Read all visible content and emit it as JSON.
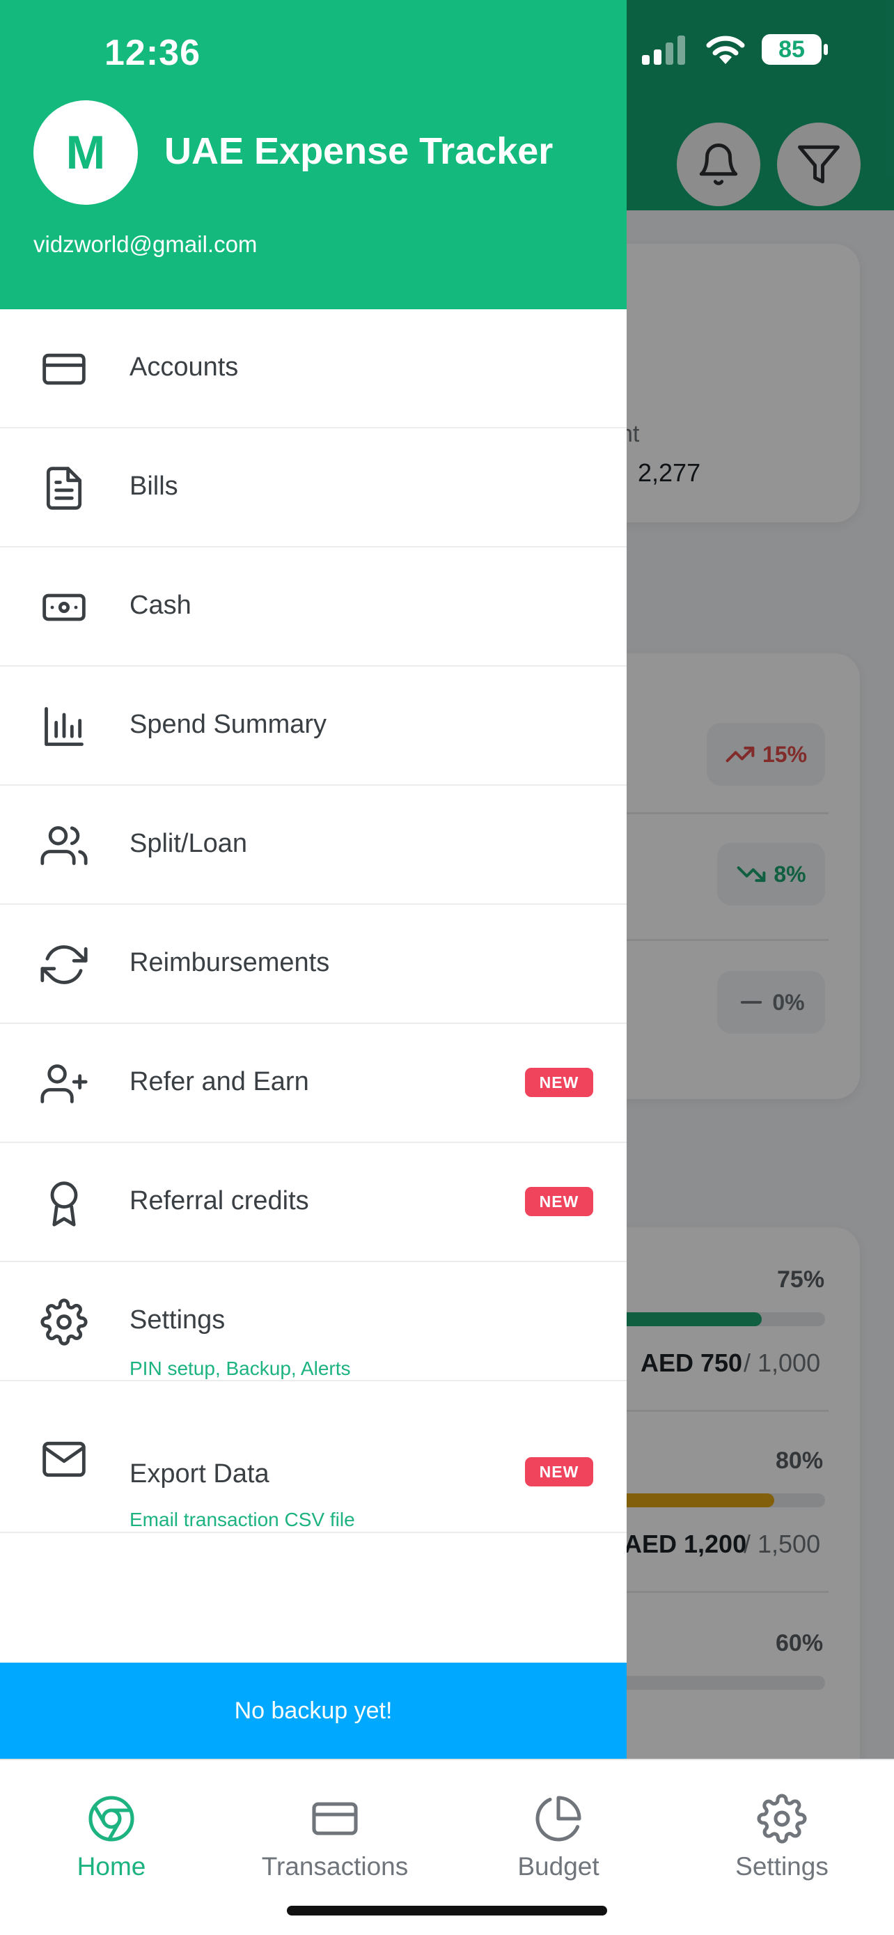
{
  "status_bar": {
    "time": "12:36",
    "battery": "85"
  },
  "background_screen": {
    "summary_label_fragment": "nt",
    "summary_value_fragment": "2,277",
    "trends": [
      {
        "value": "15%",
        "direction": "up",
        "color": "#e04a4a"
      },
      {
        "value": "8%",
        "direction": "down",
        "color": "#1aa46f"
      },
      {
        "value": "0%",
        "direction": "flat",
        "color": "#6f7479"
      }
    ],
    "budgets": [
      {
        "percent": "75%",
        "spent": "AED 750",
        "total": "/ 1,000",
        "fill_color": "#1aa46f",
        "progress": 0.75
      },
      {
        "percent": "80%",
        "spent": "AED 1,200",
        "total": "/ 1,500",
        "fill_color": "#e0a514",
        "progress": 0.8
      },
      {
        "percent": "60%"
      }
    ]
  },
  "drawer": {
    "avatar_initial": "M",
    "app_name": "UAE Expense Tracker",
    "email": "vidzworld@gmail.com",
    "menu": [
      {
        "label": "Accounts",
        "icon": "credit-card-icon"
      },
      {
        "label": "Bills",
        "icon": "document-icon"
      },
      {
        "label": "Cash",
        "icon": "cash-icon"
      },
      {
        "label": "Spend Summary",
        "icon": "bar-chart-icon"
      },
      {
        "label": "Split/Loan",
        "icon": "users-icon"
      },
      {
        "label": "Reimbursements",
        "icon": "refresh-icon"
      },
      {
        "label": "Refer and Earn",
        "icon": "user-plus-icon",
        "badge": "NEW"
      },
      {
        "label": "Referral credits",
        "icon": "award-icon",
        "badge": "NEW"
      },
      {
        "label": "Settings",
        "icon": "gear-icon",
        "sublabel": "PIN setup, Backup, Alerts"
      },
      {
        "label": "Export Data",
        "icon": "mail-icon",
        "badge": "NEW",
        "sublabel": "Email transaction CSV file"
      }
    ],
    "backup_status": "No backup yet!"
  },
  "tab_bar": {
    "tabs": [
      {
        "label": "Home",
        "active": true
      },
      {
        "label": "Transactions",
        "active": false
      },
      {
        "label": "Budget",
        "active": false
      },
      {
        "label": "Settings",
        "active": false
      }
    ]
  },
  "colors": {
    "brand_green": "#14b97e",
    "header_green_dark": "#14a673",
    "accent_text_green": "#1db381",
    "badge_red": "#f0435c",
    "backup_blue": "#00a8ff"
  }
}
